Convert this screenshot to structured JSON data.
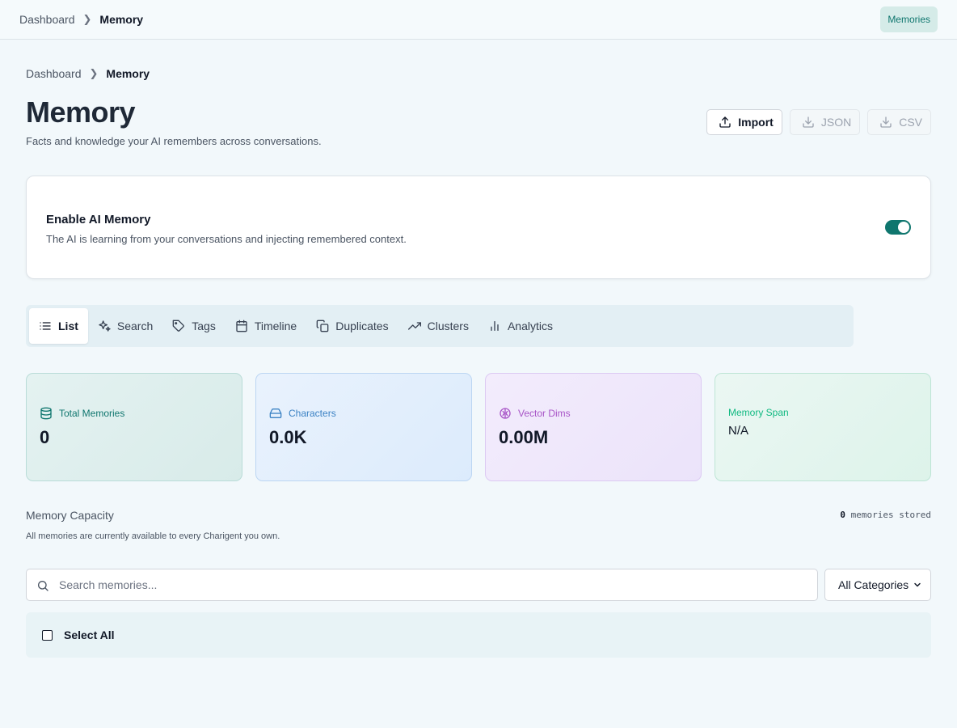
{
  "topbar": {
    "crumbs": [
      "Dashboard",
      "Memory"
    ],
    "pill_label": "Memories"
  },
  "page": {
    "crumbs": [
      "Dashboard",
      "Memory"
    ],
    "title": "Memory",
    "subtitle": "Facts and knowledge your AI remembers across conversations."
  },
  "actions": {
    "import_label": "Import",
    "json_label": "JSON",
    "csv_label": "CSV"
  },
  "enable": {
    "title": "Enable AI Memory",
    "description": "The AI is learning from your conversations and injecting remembered context.",
    "enabled": true
  },
  "tabs": [
    {
      "label": "List",
      "icon": "list-icon",
      "active": true
    },
    {
      "label": "Search",
      "icon": "sparkles-icon"
    },
    {
      "label": "Tags",
      "icon": "tag-icon"
    },
    {
      "label": "Timeline",
      "icon": "calendar-icon"
    },
    {
      "label": "Duplicates",
      "icon": "copy-icon"
    },
    {
      "label": "Clusters",
      "icon": "trend-icon"
    },
    {
      "label": "Analytics",
      "icon": "bar-chart-icon"
    }
  ],
  "stats": {
    "total": {
      "label": "Total Memories",
      "value": "0",
      "icon": "database-icon"
    },
    "characters": {
      "label": "Characters",
      "value": "0.0K",
      "icon": "drive-icon"
    },
    "vector": {
      "label": "Vector Dims",
      "value": "0.00M",
      "icon": "brain-icon"
    },
    "span": {
      "label": "Memory Span",
      "value": "N/A"
    }
  },
  "capacity": {
    "title": "Memory Capacity",
    "count": "0",
    "count_suffix": " memories stored",
    "description": "All memories are currently available to every Charigent you own."
  },
  "search": {
    "placeholder": "Search memories..."
  },
  "filter": {
    "selected": "All Categories"
  },
  "select_all_label": "Select All",
  "colors": {
    "accent": "#0f766e",
    "background": "#f2f8fb"
  }
}
